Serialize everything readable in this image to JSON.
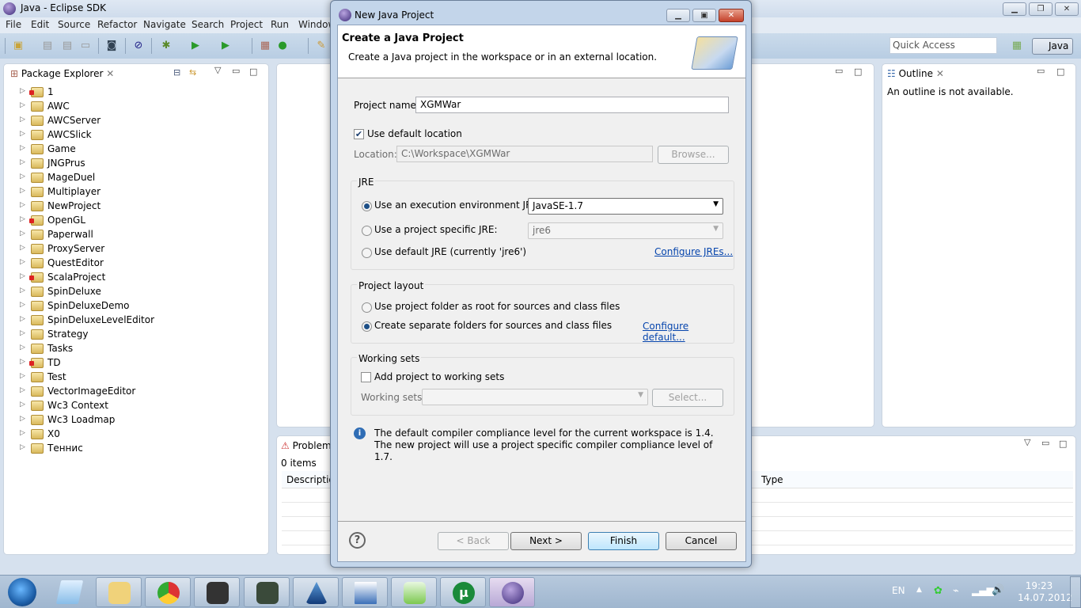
{
  "window": {
    "title": "Java - Eclipse SDK"
  },
  "menu": [
    "File",
    "Edit",
    "Source",
    "Refactor",
    "Navigate",
    "Search",
    "Project",
    "Run",
    "Window"
  ],
  "toolbar": {
    "quick_access_placeholder": "Quick Access",
    "perspective": "Java"
  },
  "package_explorer": {
    "title": "Package Explorer",
    "items": [
      {
        "label": "1",
        "error": true
      },
      {
        "label": "AWC"
      },
      {
        "label": "AWCServer"
      },
      {
        "label": "AWCSlick"
      },
      {
        "label": "Game"
      },
      {
        "label": "JNGPrus"
      },
      {
        "label": "MageDuel"
      },
      {
        "label": "Multiplayer"
      },
      {
        "label": "NewProject"
      },
      {
        "label": "OpenGL",
        "error": true
      },
      {
        "label": "Paperwall"
      },
      {
        "label": "ProxyServer"
      },
      {
        "label": "QuestEditor"
      },
      {
        "label": "ScalaProject",
        "error": true
      },
      {
        "label": "SpinDeluxe"
      },
      {
        "label": "SpinDeluxeDemo"
      },
      {
        "label": "SpinDeluxeLevelEditor"
      },
      {
        "label": "Strategy"
      },
      {
        "label": "Tasks"
      },
      {
        "label": "TD",
        "error": true
      },
      {
        "label": "Test"
      },
      {
        "label": "VectorImageEditor"
      },
      {
        "label": "Wc3 Context"
      },
      {
        "label": "Wc3 Loadmap"
      },
      {
        "label": "X0"
      },
      {
        "label": "Теннис"
      }
    ]
  },
  "outline": {
    "title": "Outline",
    "message": "An outline is not available."
  },
  "problems": {
    "title": "Problems",
    "count": "0 items",
    "columns": [
      "Description",
      "Type"
    ]
  },
  "dialog": {
    "title": "New Java Project",
    "heading": "Create a Java Project",
    "subtitle": "Create a Java project in the workspace or in an external location.",
    "project_name_label": "Project name:",
    "project_name": "XGMWar",
    "use_default_location": "Use default location",
    "location_label": "Location:",
    "location": "C:\\Workspace\\XGMWar",
    "browse": "Browse...",
    "jre": {
      "title": "JRE",
      "opt1": "Use an execution environment JRE:",
      "opt1_value": "JavaSE-1.7",
      "opt2": "Use a project specific JRE:",
      "opt2_value": "jre6",
      "opt3": "Use default JRE (currently 'jre6')",
      "configure": "Configure JREs..."
    },
    "layout": {
      "title": "Project layout",
      "opt1": "Use project folder as root for sources and class files",
      "opt2": "Create separate folders for sources and class files",
      "configure": "Configure default..."
    },
    "working_sets": {
      "title": "Working sets",
      "add": "Add project to working sets",
      "label": "Working sets:",
      "select": "Select..."
    },
    "info": "The default compiler compliance level for the current workspace is 1.4. The new project will use a project specific compiler compliance level of 1.7.",
    "buttons": {
      "back": "< Back",
      "next": "Next >",
      "finish": "Finish",
      "cancel": "Cancel"
    }
  },
  "taskbar": {
    "lang": "EN",
    "time": "19:23",
    "date": "14.07.2012"
  }
}
